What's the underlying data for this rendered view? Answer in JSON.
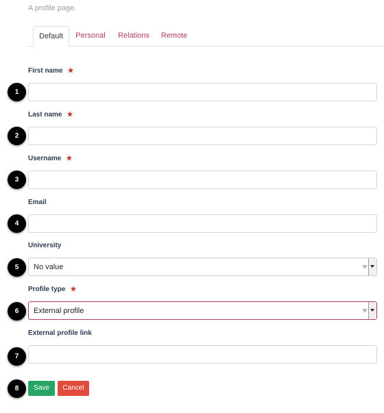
{
  "page": {
    "subtitle": "A profile page."
  },
  "tabs": [
    {
      "label": "Default",
      "active": true
    },
    {
      "label": "Personal",
      "active": false
    },
    {
      "label": "Relations",
      "active": false
    },
    {
      "label": "Remote",
      "active": false
    }
  ],
  "fields": {
    "first_name": {
      "label": "First name",
      "required": true,
      "value": "",
      "step": "1"
    },
    "last_name": {
      "label": "Last name",
      "required": true,
      "value": "",
      "step": "2"
    },
    "username": {
      "label": "Username",
      "required": true,
      "value": "",
      "step": "3"
    },
    "email": {
      "label": "Email",
      "required": false,
      "value": "",
      "step": "4"
    },
    "university": {
      "label": "University",
      "required": false,
      "value": "No value",
      "step": "5"
    },
    "profile_type": {
      "label": "Profile type",
      "required": true,
      "value": "External profile",
      "step": "6"
    },
    "external_profile_link": {
      "label": "External profile link",
      "required": false,
      "value": "",
      "step": "7"
    }
  },
  "required_marker": "★",
  "actions": {
    "save_label": "Save",
    "cancel_label": "Cancel",
    "step": "8"
  },
  "colors": {
    "tab_link": "#b0396b",
    "label": "#2e3a55",
    "required": "#c0392b",
    "save": "#28a464",
    "cancel": "#e14b3b",
    "badge": "#000000"
  },
  "icons": {
    "required": "star-icon",
    "select": "chevron-down-icon"
  }
}
